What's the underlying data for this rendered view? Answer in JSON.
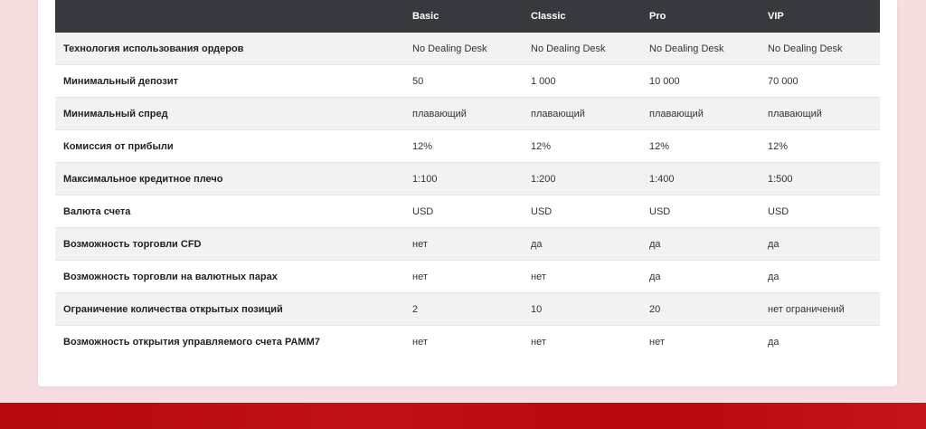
{
  "table": {
    "headers": [
      "",
      "Basic",
      "Classic",
      "Pro",
      "VIP"
    ],
    "rows": [
      {
        "label": "Технология использования ордеров",
        "values": [
          "No Dealing Desk",
          "No Dealing Desk",
          "No Dealing Desk",
          "No Dealing Desk"
        ]
      },
      {
        "label": "Минимальный депозит",
        "values": [
          "50",
          "1 000",
          "10 000",
          "70 000"
        ]
      },
      {
        "label": "Минимальный спред",
        "values": [
          "плавающий",
          "плавающий",
          "плавающий",
          "плавающий"
        ]
      },
      {
        "label": "Комиссия от прибыли",
        "values": [
          "12%",
          "12%",
          "12%",
          "12%"
        ]
      },
      {
        "label": "Максимальное кредитное плечо",
        "values": [
          "1:100",
          "1:200",
          "1:400",
          "1:500"
        ]
      },
      {
        "label": "Валюта счета",
        "values": [
          "USD",
          "USD",
          "USD",
          "USD"
        ]
      },
      {
        "label": "Возможность торговли CFD",
        "values": [
          "нет",
          "да",
          "да",
          "да"
        ]
      },
      {
        "label": "Возможность торговли на валютных парах",
        "values": [
          "нет",
          "нет",
          "да",
          "да"
        ]
      },
      {
        "label": "Ограничение количества открытых позиций",
        "values": [
          "2",
          "10",
          "20",
          "нет ограничений"
        ]
      },
      {
        "label": "Возможность открытия управляемого счета PAMM7",
        "values": [
          "нет",
          "нет",
          "нет",
          "да"
        ]
      }
    ]
  },
  "colors": {
    "page_background": "#f7dfe1",
    "header_background": "#363a3f",
    "footer_band": "#b70a0e"
  }
}
